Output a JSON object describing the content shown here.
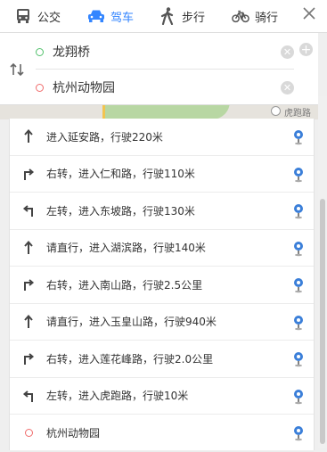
{
  "tabs": [
    {
      "label": "公交",
      "icon": "bus-icon",
      "active": false
    },
    {
      "label": "驾车",
      "icon": "car-icon",
      "active": true
    },
    {
      "label": "步行",
      "icon": "walk-icon",
      "active": false
    },
    {
      "label": "骑行",
      "icon": "bike-icon",
      "active": false
    }
  ],
  "route": {
    "start": "龙翔桥",
    "end": "杭州动物园"
  },
  "map": {
    "label": "虎跑路"
  },
  "steps": [
    {
      "text": "进入延安路，行驶220米",
      "icon": "arrow-straight-icon"
    },
    {
      "text": "右转，进入仁和路，行驶110米",
      "icon": "turn-right-icon"
    },
    {
      "text": "左转，进入东坡路，行驶130米",
      "icon": "turn-left-icon"
    },
    {
      "text": "请直行，进入湖滨路，行驶140米",
      "icon": "arrow-straight-icon"
    },
    {
      "text": "右转，进入南山路，行驶2.5公里",
      "icon": "turn-right-icon"
    },
    {
      "text": "请直行，进入玉皇山路，行驶940米",
      "icon": "arrow-straight-icon"
    },
    {
      "text": "右转，进入莲花峰路，行驶2.0公里",
      "icon": "turn-right-icon"
    },
    {
      "text": "左转，进入虎跑路，行驶10米",
      "icon": "turn-left-icon"
    },
    {
      "text": "杭州动物园",
      "icon": "destination-icon"
    }
  ],
  "colors": {
    "accent": "#3385ff",
    "start": "#52c16c",
    "end": "#f06c6c"
  }
}
